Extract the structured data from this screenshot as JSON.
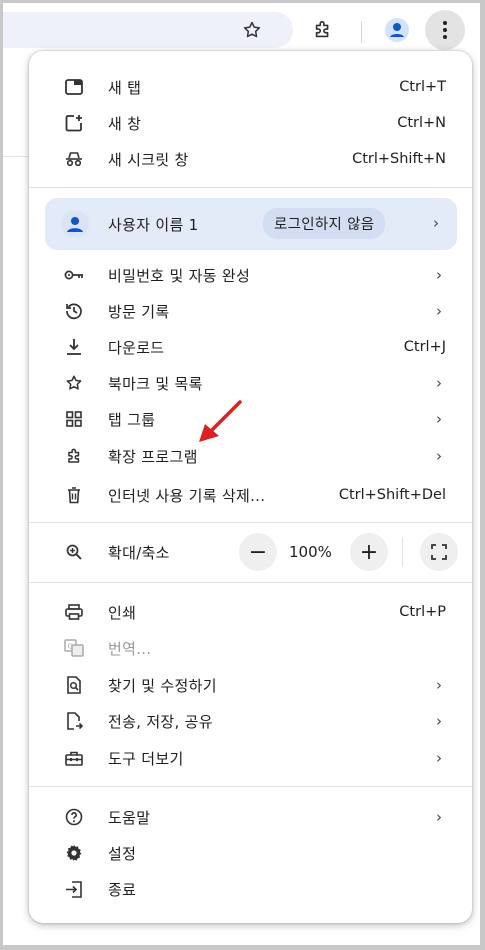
{
  "menu": {
    "items_top": [
      {
        "label": "새 탭",
        "shortcut": "Ctrl+T"
      },
      {
        "label": "새 창",
        "shortcut": "Ctrl+N"
      },
      {
        "label": "새 시크릿 창",
        "shortcut": "Ctrl+Shift+N"
      }
    ],
    "profile": {
      "name": "사용자 이름 1",
      "status": "로그인하지 않음",
      "chevron": "›"
    },
    "items_mid": [
      {
        "label": "비밀번호 및 자동 완성",
        "chevron": "›"
      },
      {
        "label": "방문 기록",
        "chevron": "›"
      },
      {
        "label": "다운로드",
        "shortcut": "Ctrl+J"
      },
      {
        "label": "북마크 및 목록",
        "chevron": "›"
      },
      {
        "label": "탭 그룹",
        "chevron": "›"
      },
      {
        "label": "확장 프로그램",
        "chevron": "›"
      },
      {
        "label": "인터넷 사용 기록 삭제...",
        "shortcut": "Ctrl+Shift+Del"
      }
    ],
    "zoom": {
      "label": "확대/축소",
      "minus": "−",
      "value": "100%",
      "plus": "+"
    },
    "items_tools": [
      {
        "label": "인쇄",
        "shortcut": "Ctrl+P"
      },
      {
        "label": "번역..."
      },
      {
        "label": "찾기 및 수정하기",
        "chevron": "›"
      },
      {
        "label": "전송, 저장, 공유",
        "chevron": "›"
      },
      {
        "label": "도구 더보기",
        "chevron": "›"
      }
    ],
    "items_bottom": [
      {
        "label": "도움말",
        "chevron": "›"
      },
      {
        "label": "설정"
      },
      {
        "label": "종료"
      }
    ]
  },
  "colors": {
    "accent": "#0b57d0",
    "annotation_arrow": "#e02020",
    "menu_bg": "#ffffff",
    "profile_bg": "#e4ebf8"
  },
  "icons": [
    "star-icon",
    "extension-icon",
    "profile-avatar-icon",
    "more-vert-icon",
    "new-tab-icon",
    "new-window-icon",
    "incognito-icon",
    "person-icon",
    "key-icon",
    "history-icon",
    "download-icon",
    "star-icon",
    "apps-icon",
    "extension-icon",
    "trash-icon",
    "zoom-icon",
    "fullscreen-icon",
    "print-icon",
    "translate-icon",
    "find-icon",
    "share-icon",
    "toolbox-icon",
    "help-icon",
    "settings-icon",
    "exit-icon"
  ]
}
